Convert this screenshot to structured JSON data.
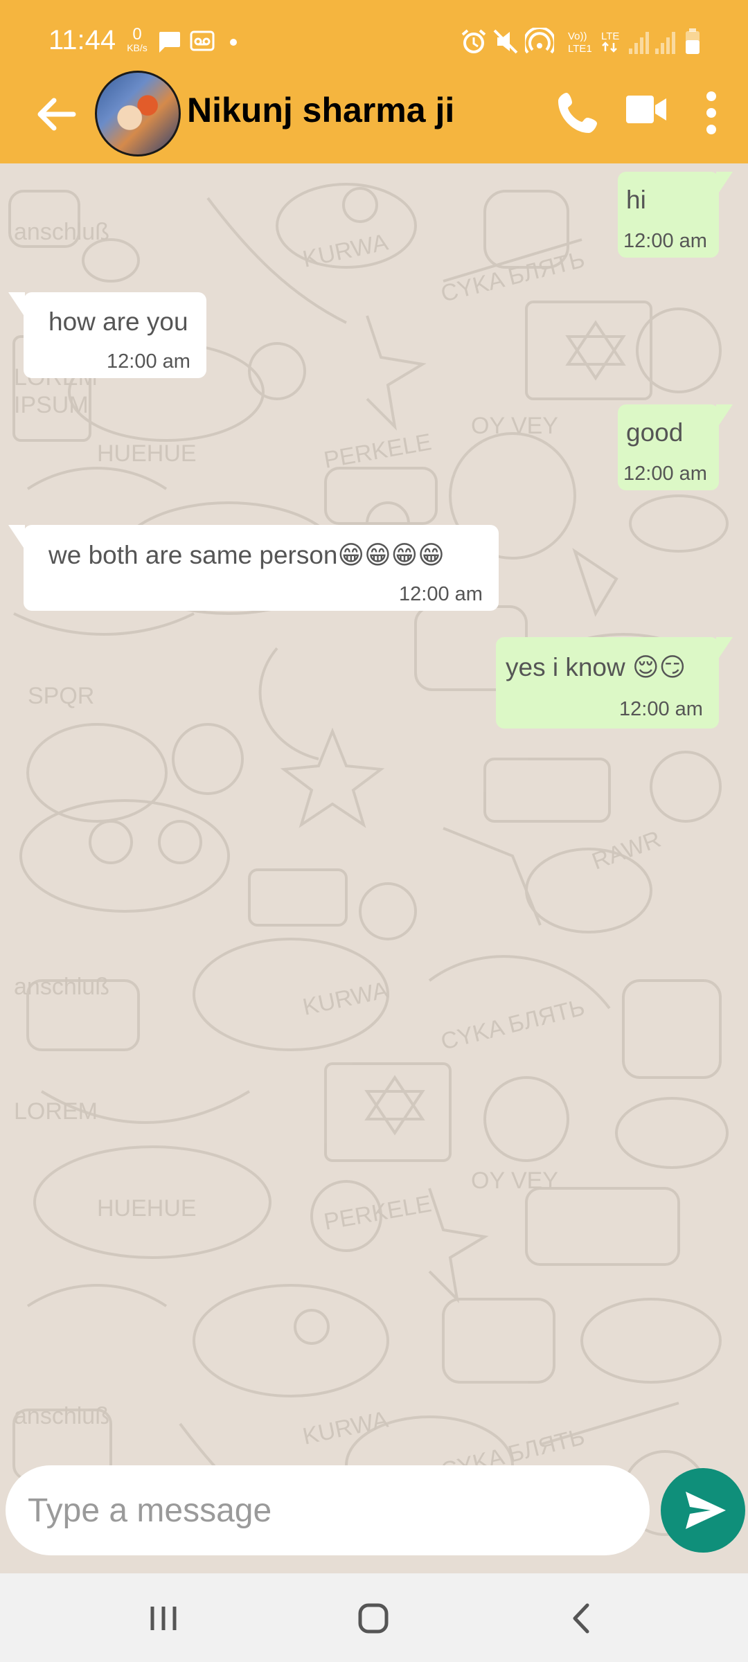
{
  "colors": {
    "header": "#f5b53f",
    "chat_bg": "#e6ddd4",
    "outgoing_bubble": "#dcf8c6",
    "incoming_bubble": "#ffffff",
    "send_button": "#0f8f7a"
  },
  "status_bar": {
    "time": "11:44",
    "speed_value": "0",
    "speed_unit": "KB/s",
    "network_label_1": "Vo)) LTE1",
    "network_label_2": "LTE"
  },
  "header": {
    "contact_name": "Nikunj sharma ji",
    "icons": [
      "back-arrow-icon",
      "phone-icon",
      "video-call-icon",
      "more-options-icon"
    ]
  },
  "messages": [
    {
      "direction": "out",
      "text": "hi",
      "time": "12:00 am"
    },
    {
      "direction": "in",
      "text": "how are you",
      "time": "12:00 am"
    },
    {
      "direction": "out",
      "text": "good",
      "time": "12:00 am"
    },
    {
      "direction": "in",
      "text": "we both are same person😁😁😁😁",
      "time": "12:00 am"
    },
    {
      "direction": "out",
      "text": "yes i know 😌😏",
      "time": "12:00 am"
    }
  ],
  "composer": {
    "placeholder": "Type a message",
    "value": ""
  },
  "nav": {
    "icons": [
      "recent-apps-icon",
      "home-icon",
      "back-icon"
    ]
  }
}
